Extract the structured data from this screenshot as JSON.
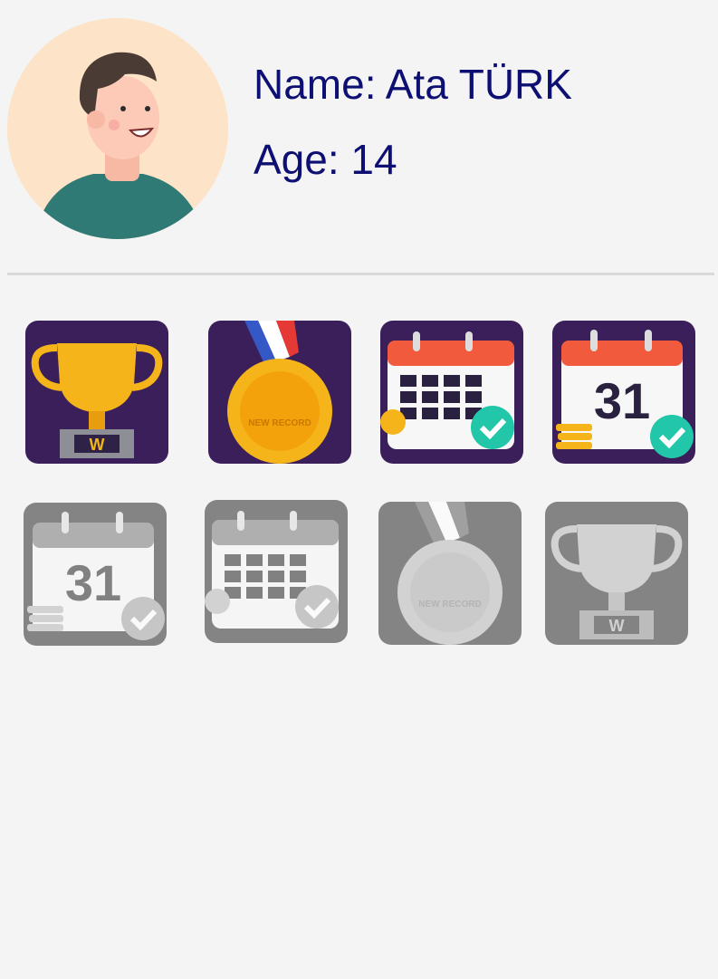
{
  "profile": {
    "name_text": "Name: Ata TÜRK",
    "age_text": "Age: 14",
    "avatar_icon": "boy-avatar-icon"
  },
  "colors": {
    "text": "#0d0f73",
    "background": "#f4f4f4",
    "badge_background": "#3b1f5a",
    "gold": "#f5b51a",
    "calendar_red": "#f15a3d",
    "check_green": "#22c7a9"
  },
  "badges": [
    {
      "name": "gold-trophy-badge-icon",
      "label": "W",
      "status": "earned"
    },
    {
      "name": "gold-medal-badge-icon",
      "label": "NEW RECORD",
      "status": "earned"
    },
    {
      "name": "calendar-check-badge-icon",
      "status": "earned"
    },
    {
      "name": "calendar-31-badge-icon",
      "label": "31",
      "status": "earned"
    },
    {
      "name": "calendar-31-badge-icon",
      "label": "31",
      "status": "locked"
    },
    {
      "name": "calendar-check-badge-icon",
      "status": "locked"
    },
    {
      "name": "silver-medal-badge-icon",
      "label": "NEW RECORD",
      "status": "locked"
    },
    {
      "name": "silver-trophy-badge-icon",
      "label": "W",
      "status": "locked"
    }
  ]
}
